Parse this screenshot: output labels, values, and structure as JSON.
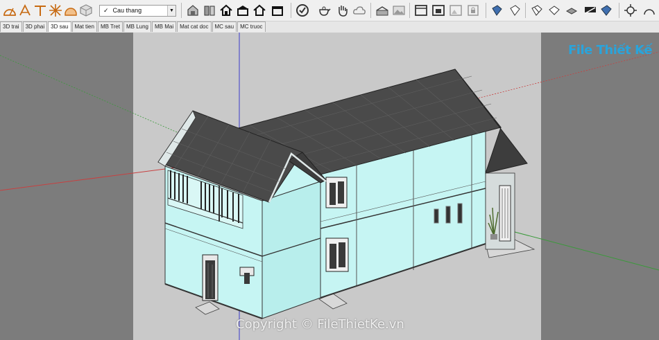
{
  "toolbar": {
    "icons": [
      "protractor-icon",
      "text-label-icon",
      "axes-icon",
      "section-icon",
      "dimension-icon",
      "component-icon",
      "paint-bucket-icon",
      "house-icon",
      "house-front-icon",
      "house-top-icon",
      "house-open-icon",
      "house-side-icon",
      "checkmark-icon",
      "teapot-icon",
      "hand-icon",
      "cloud-icon",
      "warehouse-icon",
      "photo-icon",
      "window-icon",
      "window-camera-icon",
      "window-landscape-icon",
      "lock-icon",
      "iso-view-icon",
      "top-view-icon",
      "front-view-icon",
      "right-view-icon",
      "back-view-icon",
      "left-view-icon",
      "orbit-icon",
      "walk-icon"
    ],
    "layer_dropdown": {
      "checked": "✓",
      "label": "Cau thang"
    }
  },
  "tabs": [
    {
      "label": "3D trai"
    },
    {
      "label": "3D phai"
    },
    {
      "label": "3D sau",
      "active": true
    },
    {
      "label": "Mat tien"
    },
    {
      "label": "MB Tret"
    },
    {
      "label": "MB Lung"
    },
    {
      "label": "MB Mai"
    },
    {
      "label": "Mat cat doc"
    },
    {
      "label": "MC sau"
    },
    {
      "label": "MC truoc"
    }
  ],
  "watermark": {
    "brand": "File Thiết Kế",
    "domain": ".vn"
  },
  "copyright": "Copyright © FileThietKe.vn",
  "colors": {
    "wall": "#c6f5f3",
    "wall_side": "#b6ecea",
    "roof": "#4a4a4a",
    "sky": "#c9c9c9",
    "left_panel": "#7c7c7c",
    "ground": "#ececec"
  }
}
